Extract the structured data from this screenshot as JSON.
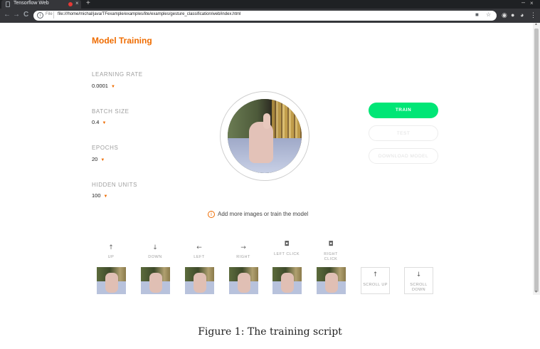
{
  "browser": {
    "tab_title": "Tensorflow Web",
    "tab_close": "×",
    "new_tab": "+",
    "minimize": "–",
    "close": "×",
    "back": "←",
    "forward": "→",
    "reload": "C",
    "url_scheme": "File",
    "url": "file:///home/michal/java/TFexample/examples/lite/examples/gesture_classification/web/index.html",
    "info_glyph": "i",
    "camera_icon": "camera-icon",
    "star_icon": "star-icon"
  },
  "page": {
    "title": "Model Training",
    "params": [
      {
        "label": "LEARNING RATE",
        "value": "0.0001"
      },
      {
        "label": "BATCH SIZE",
        "value": "0.4"
      },
      {
        "label": "EPOCHS",
        "value": "20"
      },
      {
        "label": "HIDDEN UNITS",
        "value": "100"
      }
    ],
    "buttons": {
      "train": "TRAIN",
      "test": "TEST",
      "download": "DOWNLOAD MODEL"
    },
    "hint": "Add more images or train the model",
    "hint_glyph": "i",
    "controls": [
      {
        "icon": "↑",
        "label": "UP",
        "icon_name": "arrow-up-icon"
      },
      {
        "icon": "↓",
        "label": "DOWN",
        "icon_name": "arrow-down-icon"
      },
      {
        "icon": "←",
        "label": "LEFT",
        "icon_name": "arrow-left-icon"
      },
      {
        "icon": "→",
        "label": "RIGHT",
        "icon_name": "arrow-right-icon"
      },
      {
        "icon": "◘",
        "label": "LEFT CLICK",
        "icon_name": "mouse-left-icon"
      },
      {
        "icon": "◘",
        "label": "RIGHT CLICK",
        "icon_name": "mouse-right-icon"
      }
    ],
    "scroll_controls": [
      {
        "icon": "↑",
        "label": "SCROLL UP"
      },
      {
        "icon": "↓",
        "label": "SCROLL DOWN"
      }
    ]
  },
  "caption": "Figure 1: The training script",
  "colors": {
    "accent": "#ef6c00",
    "train_button": "#00e676",
    "chrome_dark": "#35363a"
  }
}
